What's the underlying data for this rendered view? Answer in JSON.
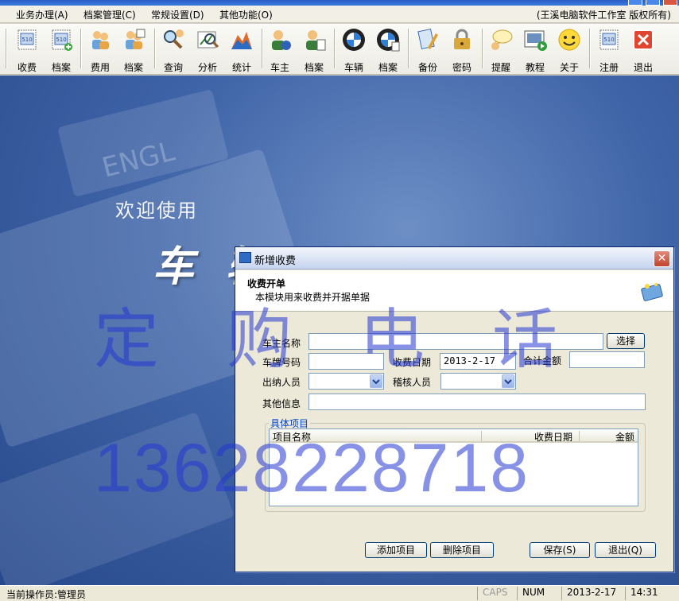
{
  "menu": {
    "items": [
      "业务办理(A)",
      "档案管理(C)",
      "常规设置(D)",
      "其他功能(O)"
    ],
    "copyright": "(王溪电脑软件工作室 版权所有)"
  },
  "toolbar": {
    "buttons": [
      {
        "label": "收费",
        "icon": "stamp-icon"
      },
      {
        "label": "档案",
        "icon": "stamp-add-icon"
      },
      {
        "label": "费用",
        "icon": "users-icon"
      },
      {
        "label": "档案",
        "icon": "users-add-icon"
      },
      {
        "label": "查询",
        "icon": "magnifier-icon"
      },
      {
        "label": "分析",
        "icon": "analysis-icon"
      },
      {
        "label": "统计",
        "icon": "chart-icon"
      },
      {
        "label": "车主",
        "icon": "owner-icon"
      },
      {
        "label": "档案",
        "icon": "owner-file-icon"
      },
      {
        "label": "车辆",
        "icon": "car-logo-icon"
      },
      {
        "label": "档案",
        "icon": "car-logo-file-icon"
      },
      {
        "label": "备份",
        "icon": "backup-icon"
      },
      {
        "label": "密码",
        "icon": "lock-icon"
      },
      {
        "label": "提醒",
        "icon": "reminder-icon"
      },
      {
        "label": "教程",
        "icon": "tutorial-icon"
      },
      {
        "label": "关于",
        "icon": "smiley-icon"
      },
      {
        "label": "注册",
        "icon": "register-icon"
      },
      {
        "label": "退出",
        "icon": "exit-icon"
      }
    ]
  },
  "desktop": {
    "welcome": "欢迎使用",
    "title_partial": "车辆",
    "bg_text": "ENGL"
  },
  "dialog": {
    "title": "新增收费",
    "header_title": "收费开单",
    "header_desc": "本模块用来收费并开据单据",
    "labels": {
      "owner_name": "车主名称",
      "plate": "车牌号码",
      "charge_date": "收费日期",
      "total": "合计金额",
      "cashier": "出纳人员",
      "auditor": "稽核人员",
      "other": "其他信息"
    },
    "values": {
      "owner_name": "",
      "plate": "",
      "charge_date": "2013-2-17",
      "total": "",
      "cashier": "",
      "auditor": "",
      "other": ""
    },
    "select_button": "选择",
    "group_title": "具体项目",
    "columns": [
      "项目名称",
      "收费日期",
      "金额"
    ],
    "rows": [],
    "buttons": {
      "add": "添加项目",
      "delete": "删除项目",
      "save": "保存(S)",
      "exit": "退出(Q)"
    }
  },
  "watermark": {
    "line1": "定购电话",
    "line2": "13628228718"
  },
  "statusbar": {
    "operator": "当前操作员:管理员",
    "caps": "CAPS",
    "num": "NUM",
    "date": "2013-2-17",
    "time": "14:31"
  }
}
